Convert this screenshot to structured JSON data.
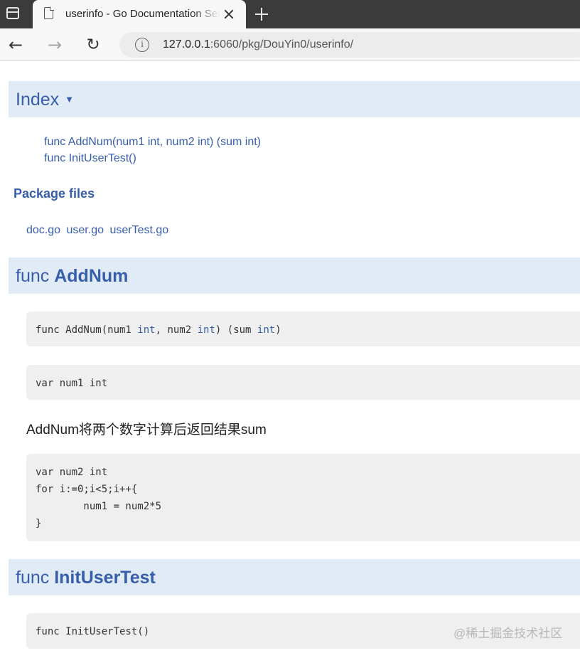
{
  "browser": {
    "tab_title": "userinfo - Go Documentation Server",
    "url_host": "127.0.0.1",
    "url_rest": ":6060/pkg/DouYin0/userinfo/",
    "back_icon": "←",
    "forward_icon": "→",
    "reload_icon": "↻",
    "info_icon": "i"
  },
  "index": {
    "title": "Index",
    "caret": "▼",
    "links": [
      "func AddNum(num1 int, num2 int) (sum int)",
      "func InitUserTest()"
    ]
  },
  "package_files": {
    "heading": "Package files",
    "files": [
      "doc.go",
      "user.go",
      "userTest.go"
    ]
  },
  "funcs": {
    "addnum": {
      "prefix": "func",
      "name": "AddNum",
      "sig_a": "func AddNum(num1 ",
      "sig_t1": "int",
      "sig_b": ", num2 ",
      "sig_t2": "int",
      "sig_c": ") (sum ",
      "sig_t3": "int",
      "sig_d": ")",
      "var_code": "var num1 int",
      "doc": "AddNum将两个数字计算后返回结果sum",
      "example_code": "var num2 int\nfor i:=0;i<5;i++{\n        num1 = num2*5\n}"
    },
    "inituser": {
      "prefix": "func",
      "name": "InitUserTest",
      "signature": "func InitUserTest()"
    }
  },
  "watermark": "@稀土掘金技术社区"
}
